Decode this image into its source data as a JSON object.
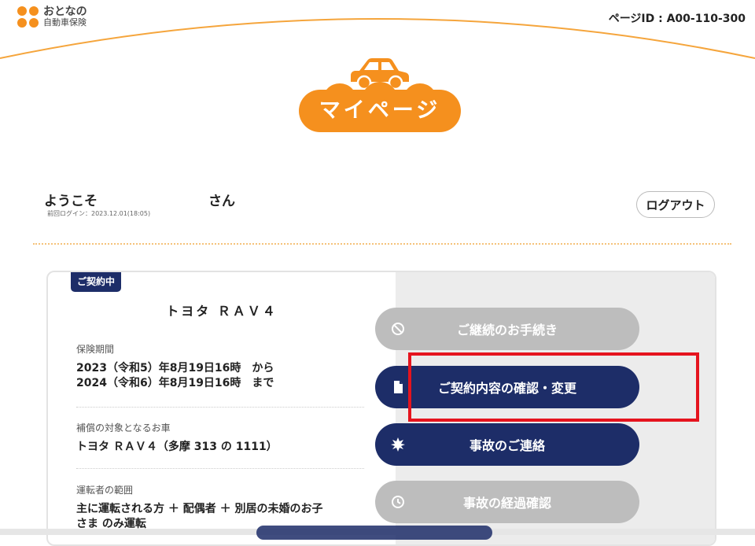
{
  "header": {
    "logo_main": "おとなの",
    "logo_sub": "自動車保険",
    "page_id": "ページID : A00-110-300"
  },
  "hero": {
    "title": "マイページ"
  },
  "user": {
    "welcome": "ようこそ",
    "suffix": "さん",
    "last_login": "前回ログイン：2023.12.01(18:05)",
    "logout_label": "ログアウト"
  },
  "contract": {
    "status_badge": "ご契約中",
    "car_name": "トヨタ ＲＡＶ４",
    "period_label": "保険期間",
    "period_from": "2023（令和5）年8月19日16時　から",
    "period_to": "2024（令和6）年8月19日16時　まで",
    "vehicle_label": "補償の対象となるお車",
    "vehicle_value": "トヨタ ＲＡＶ４（多摩 313 の 1111）",
    "driver_label": "運転者の範囲",
    "driver_line1": "主に運転される方 ＋ 配偶者 ＋ 別居の未婚のお子",
    "driver_line2": "さま のみ運転"
  },
  "actions": [
    {
      "label": "ご継続のお手続き",
      "state": "disabled",
      "icon": "block-icon"
    },
    {
      "label": "ご契約内容の確認・変更",
      "state": "active",
      "icon": "document-icon"
    },
    {
      "label": "事故のご連絡",
      "state": "active",
      "icon": "alert-burst-icon"
    },
    {
      "label": "事故の経過確認",
      "state": "disabled",
      "icon": "clock-icon"
    }
  ],
  "colors": {
    "brand_orange": "#f5901e",
    "navy": "#1d2d68",
    "disabled_gray": "#bdbdbd",
    "highlight_red": "#e5141e"
  }
}
